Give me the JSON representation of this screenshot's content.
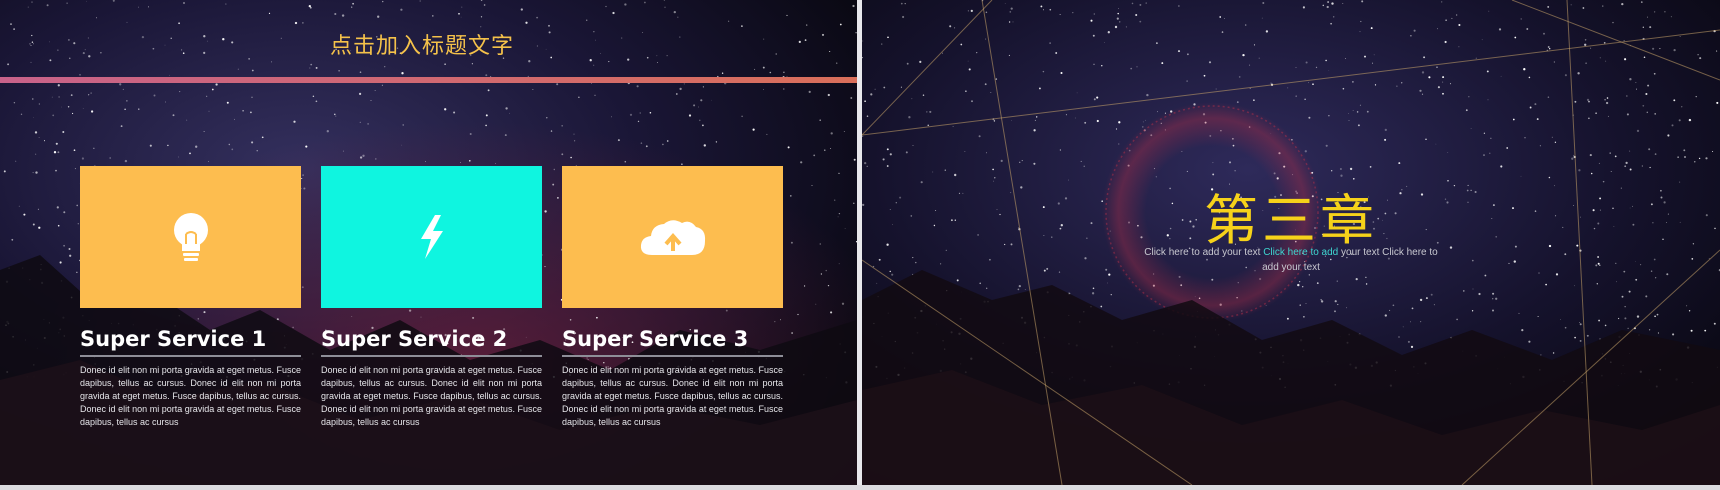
{
  "left_slide": {
    "title": "点击加入标题文字",
    "services": [
      {
        "title": "Super Service 1",
        "icon": "lightbulb-icon",
        "color": "#fdbd4f",
        "body": "Donec id elit non mi porta gravida at eget metus. Fusce dapibus, tellus ac cursus. Donec id elit non mi porta gravida at eget metus. Fusce dapibus, tellus ac cursus. Donec id elit non mi porta gravida at eget metus. Fusce dapibus, tellus ac cursus"
      },
      {
        "title": "Super Service 2",
        "icon": "lightning-icon",
        "color": "#0ff5e0",
        "body": "Donec id elit non mi porta gravida at eget metus. Fusce dapibus, tellus ac cursus. Donec id elit non mi porta gravida at eget metus. Fusce dapibus, tellus ac cursus. Donec id elit non mi porta gravida at eget metus. Fusce dapibus, tellus ac cursus"
      },
      {
        "title": "Super Service 3",
        "icon": "cloud-upload-icon",
        "color": "#fdbd4f",
        "body": "Donec id elit non mi porta gravida at eget metus. Fusce dapibus, tellus ac cursus. Donec id elit non mi porta gravida at eget metus. Fusce dapibus, tellus ac cursus. Donec id elit non mi porta gravida at eget metus. Fusce dapibus, tellus ac cursus"
      }
    ]
  },
  "right_slide": {
    "chapter": "第三章",
    "subtext_1": "Click here to add your text ",
    "subtext_highlight": "Click here to add",
    "subtext_2": " your text Click here to add your text"
  },
  "colors": {
    "accent_yellow": "#f5c24a",
    "accent_cyan": "#3fd6d0",
    "chapter_gold": "#f6d21a"
  }
}
